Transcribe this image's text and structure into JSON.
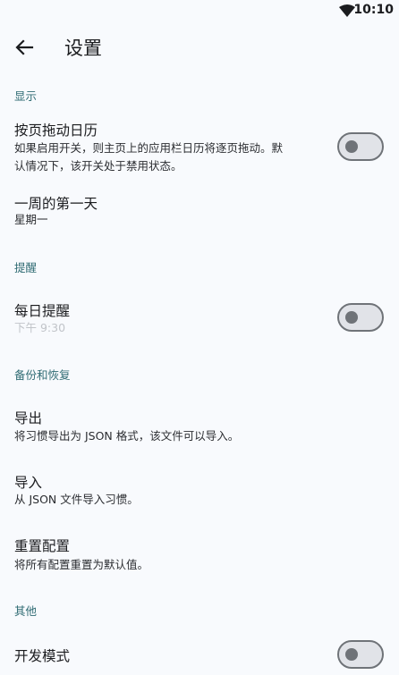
{
  "status_bar": {
    "time": "10:10",
    "wifi_icon": "wifi-icon"
  },
  "app_bar": {
    "back_icon": "arrow-back-icon",
    "title": "设置"
  },
  "sections": {
    "display": {
      "header": "显示",
      "swipe_calendar": {
        "title": "按页拖动日历",
        "desc_line1": "如果启用开关，则主页上的应用栏日历将逐页拖动。默",
        "desc_line2": "认情况下，该开关处于禁用状态。",
        "enabled": false
      },
      "first_day": {
        "title": "一周的第一天",
        "value": "星期一"
      }
    },
    "reminder": {
      "header": "提醒",
      "daily": {
        "title": "每日提醒",
        "time": "下午 9:30",
        "enabled": false
      }
    },
    "backup": {
      "header": "备份和恢复",
      "export": {
        "title": "导出",
        "desc": "将习惯导出为 JSON 格式，该文件可以导入。"
      },
      "import": {
        "title": "导入",
        "desc": "从 JSON 文件导入习惯。"
      },
      "reset": {
        "title": "重置配置",
        "desc": "将所有配置重置为默认值。"
      }
    },
    "other": {
      "header": "其他",
      "dev_mode": {
        "title": "开发模式",
        "enabled": false
      }
    }
  },
  "colors": {
    "background": "#f8fafd",
    "section_header": "#2f6b73",
    "toggle_outline": "#6f7378",
    "toggle_track": "#e1e3e8"
  }
}
